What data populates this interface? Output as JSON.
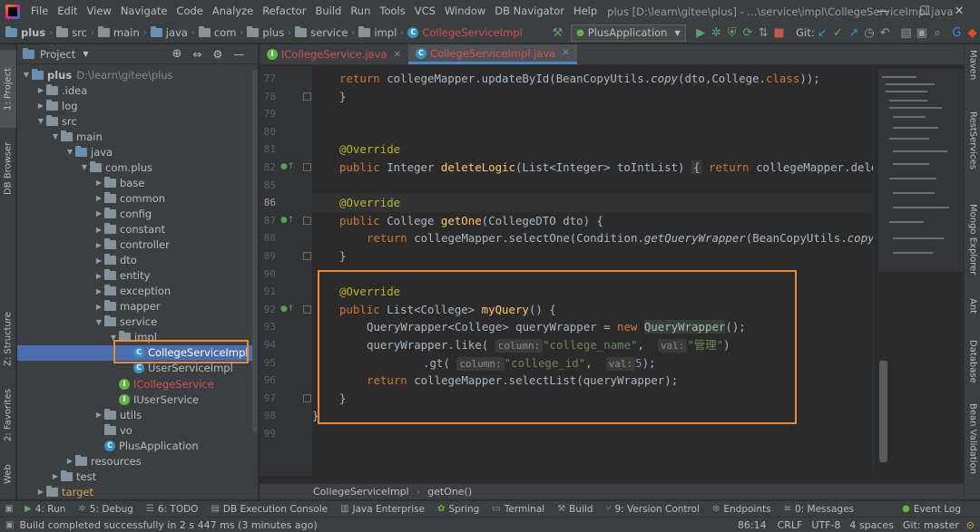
{
  "window": {
    "menu": [
      "File",
      "Edit",
      "View",
      "Navigate",
      "Code",
      "Analyze",
      "Refactor",
      "Build",
      "Run",
      "Tools",
      "VCS",
      "Window",
      "DB Navigator",
      "Help"
    ],
    "title": "plus [D:\\learn\\gitee\\plus] - ...\\service\\impl\\CollegeServiceImpl.java",
    "minimize": "—",
    "maximize": "☐",
    "close": "✕"
  },
  "navbar": {
    "crumbs": [
      "plus",
      "src",
      "main",
      "java",
      "com",
      "plus",
      "service",
      "impl",
      "CollegeServiceImpl"
    ],
    "run_config": "PlusApplication",
    "git_label": "Git:"
  },
  "left_strip": {
    "project": "1: Project",
    "db_browser": "DB Browser",
    "structure": "Z: Structure",
    "favorites": "2: Favorites",
    "web": "Web"
  },
  "right_strip": {
    "maven": "Maven",
    "rest_services": "RestServices",
    "mongo": "Mongo Explorer",
    "ant": "Ant",
    "database": "Database",
    "bean_validation": "Bean Validation"
  },
  "project_panel": {
    "title": "Project",
    "tree": [
      {
        "label": "plus",
        "extra": "D:\\learn\\gitee\\plus",
        "depth": 0,
        "expanded": true
      },
      {
        "label": ".idea",
        "depth": 1,
        "expanded": false
      },
      {
        "label": "log",
        "depth": 1,
        "expanded": false
      },
      {
        "label": "src",
        "depth": 1,
        "expanded": true
      },
      {
        "label": "main",
        "depth": 2,
        "expanded": true
      },
      {
        "label": "java",
        "depth": 3,
        "expanded": true
      },
      {
        "label": "com.plus",
        "depth": 4,
        "expanded": true
      },
      {
        "label": "base",
        "depth": 5,
        "expanded": false
      },
      {
        "label": "common",
        "depth": 5,
        "expanded": false
      },
      {
        "label": "config",
        "depth": 5,
        "expanded": false
      },
      {
        "label": "constant",
        "depth": 5,
        "expanded": false
      },
      {
        "label": "controller",
        "depth": 5,
        "expanded": false
      },
      {
        "label": "dto",
        "depth": 5,
        "expanded": false
      },
      {
        "label": "entity",
        "depth": 5,
        "expanded": false
      },
      {
        "label": "exception",
        "depth": 5,
        "expanded": false
      },
      {
        "label": "mapper",
        "depth": 5,
        "expanded": false
      },
      {
        "label": "service",
        "depth": 5,
        "expanded": true
      },
      {
        "label": "impl",
        "depth": 6,
        "expanded": true
      },
      {
        "label": "CollegeServiceImpl",
        "depth": 7,
        "selected": true
      },
      {
        "label": "UserServiceImpl",
        "depth": 7
      },
      {
        "label": "ICollegeService",
        "depth": 6
      },
      {
        "label": "IUserService",
        "depth": 6
      },
      {
        "label": "utils",
        "depth": 5,
        "expanded": false
      },
      {
        "label": "vo",
        "depth": 5
      },
      {
        "label": "PlusApplication",
        "depth": 5
      },
      {
        "label": "resources",
        "depth": 3,
        "expanded": false
      },
      {
        "label": "test",
        "depth": 2,
        "expanded": false
      },
      {
        "label": "target",
        "depth": 1,
        "expanded": false
      }
    ]
  },
  "editor": {
    "tabs": [
      {
        "label": "ICollegeService.java",
        "active": false
      },
      {
        "label": "CollegeServiceImpl.java",
        "active": true
      }
    ],
    "line_numbers": [
      "77",
      "78",
      "79",
      "80",
      "81",
      "82",
      "85",
      "86",
      "87",
      "88",
      "89",
      "90",
      "91",
      "92",
      "93",
      "94",
      "95",
      "96",
      "97",
      "98",
      "99"
    ],
    "code": {
      "l77_return": "return",
      "l77_rest": " collegeMapper.updateById(BeanCopyUtils.",
      "l77_copy": "copy",
      "l77_tail": "(dto,College.",
      "l77_class": "class",
      "l77_end": "));",
      "l78": "}",
      "l81_ann": "@Override",
      "l82_public": "public",
      "l82_sig": " Integer ",
      "l82_name": "deleteLogic",
      "l82_params": "(List<Integer> toIntList) ",
      "l82_fold_open": "{",
      "l82_return": " return",
      "l82_tail": " collegeMapper.dele",
      "l86_ann": "@Override",
      "l87_public": "public",
      "l87_sig": " College ",
      "l87_name": "getOne",
      "l87_params": "(CollegeDTO dto) {",
      "l88_return": "return",
      "l88_rest": " collegeMapper.selectOne(Condition.",
      "l88_gqw": "getQueryWrapper",
      "l88_tail": "(BeanCopyUtils.",
      "l88_copy": "copy",
      "l89": "}",
      "l91_ann": "@Override",
      "l92_public": "public",
      "l92_sig": " List<College> ",
      "l92_name": "myQuery",
      "l92_params": "() {",
      "l93_a": "QueryWrapper<College> queryWrapper = ",
      "l93_new": "new",
      "l93_cls": "QueryWrapper",
      "l93_end": "();",
      "l94_a": "queryWrapper.like( ",
      "l94_hint1": "column:",
      "l94_s1": "\"college_name\"",
      "l94_comma": ",  ",
      "l94_hint2": "val:",
      "l94_s2": "\"管理\"",
      "l94_end": ")",
      "l95_a": ".gt( ",
      "l95_hint1": "column:",
      "l95_s1": "\"college_id\"",
      "l95_comma": ",  ",
      "l95_hint2": "val:",
      "l95_n": "5",
      "l95_end": ");",
      "l96_return": "return",
      "l96_rest": " collegeMapper.selectList(queryWrapper);",
      "l97": "}",
      "l98": "}"
    },
    "breadcrumbs": [
      "CollegeServiceImpl",
      "getOne()"
    ]
  },
  "bottom_tabs": [
    "4: Run",
    "5: Debug",
    "6: TODO",
    "DB Execution Console",
    "Java Enterprise",
    "Spring",
    "Terminal",
    "Build",
    "9: Version Control",
    "Endpoints",
    "0: Messages",
    "Event Log"
  ],
  "status": {
    "message": "Build completed successfully in 2 s 447 ms (3 minutes ago)",
    "position": "86:14",
    "line_sep": "CRLF",
    "encoding": "UTF-8",
    "indent": "4 spaces",
    "branch": "Git: master"
  },
  "colors": {
    "accent": "#4a88c7",
    "selection": "#4b6eaf",
    "annotation_box": "#ec8a3c",
    "keyword": "#cc7832",
    "string": "#6a8759",
    "method": "#ffc66d",
    "annotation": "#bbb529"
  }
}
